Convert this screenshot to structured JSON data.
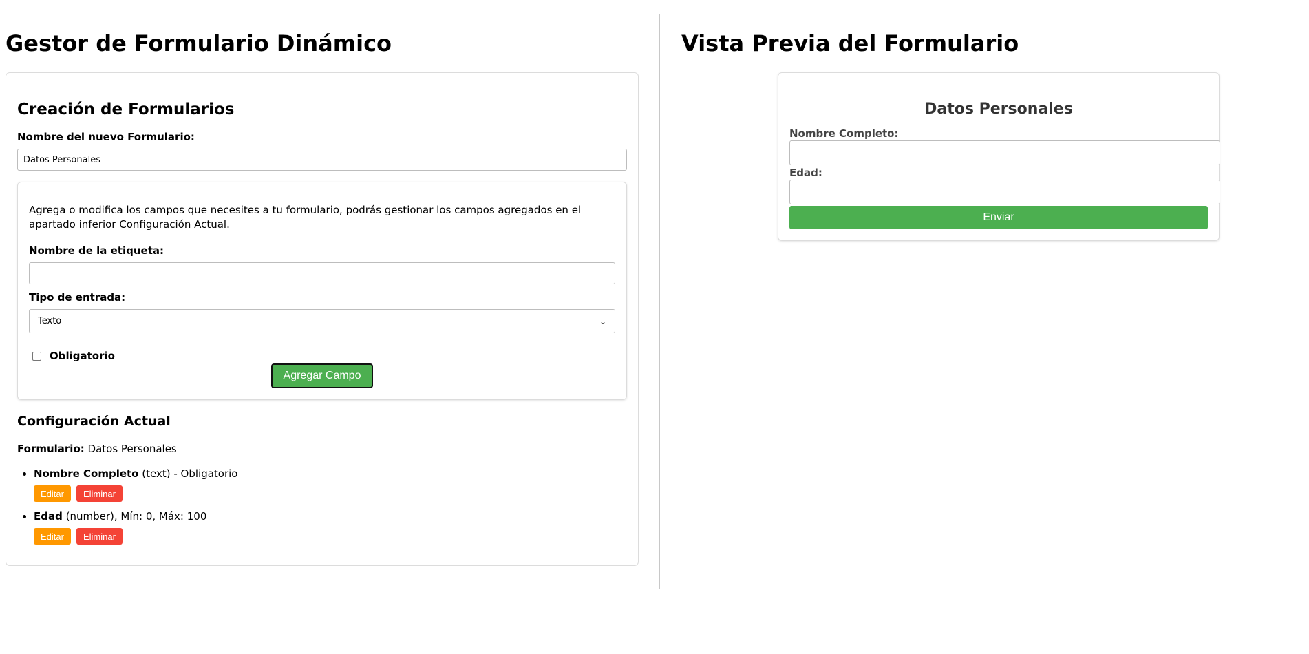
{
  "left": {
    "title": "Gestor de Formulario Dinámico",
    "creation": {
      "heading": "Creación de Formularios",
      "name_label": "Nombre del nuevo Formulario:",
      "name_value": "Datos Personales"
    },
    "field_editor": {
      "description": "Agrega o modifica los campos que necesites a tu formulario, podrás gestionar los campos agregados en el apartado inferior Configuración Actual.",
      "tag_label": "Nombre de la etiqueta:",
      "tag_value": "",
      "type_label": "Tipo de entrada:",
      "type_selected": "Texto",
      "required_label": "Obligatorio",
      "add_button": "Agregar Campo"
    },
    "config": {
      "heading": "Configuración Actual",
      "form_label": "Formulario:",
      "form_name": "Datos Personales",
      "fields": [
        {
          "name": "Nombre Completo",
          "detail": "(text) - Obligatorio",
          "edit": "Editar",
          "delete": "Eliminar"
        },
        {
          "name": "Edad",
          "detail": "(number), Mín: 0, Máx: 100",
          "edit": "Editar",
          "delete": "Eliminar"
        }
      ]
    }
  },
  "right": {
    "title": "Vista Previa del Formulario",
    "preview": {
      "form_title": "Datos Personales",
      "fields": [
        {
          "label": "Nombre Completo:"
        },
        {
          "label": "Edad:"
        }
      ],
      "submit": "Enviar"
    }
  },
  "colors": {
    "primary_green": "#4caf50",
    "edit_orange": "#ff9800",
    "delete_red": "#f44336"
  }
}
